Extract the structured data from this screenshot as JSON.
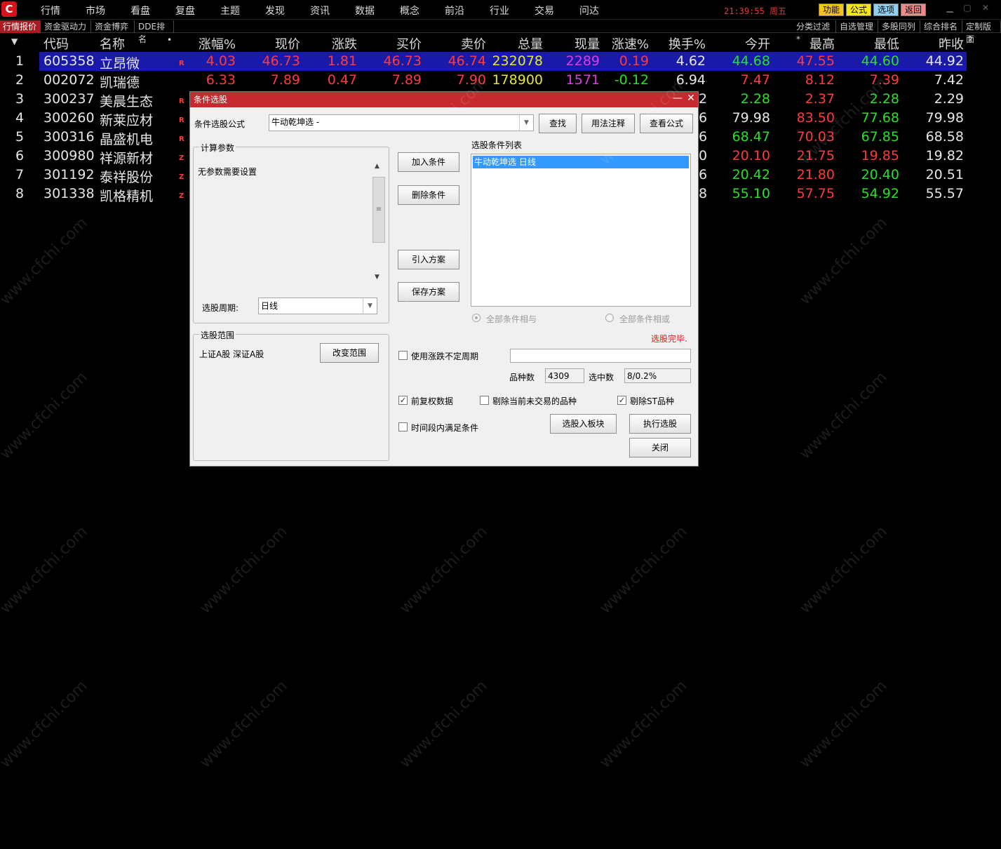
{
  "app": {
    "logo_glyph": "C"
  },
  "menu": [
    "行情",
    "市场",
    "看盘",
    "复盘",
    "主题",
    "发现",
    "资讯",
    "数据",
    "概念",
    "前沿",
    "行业",
    "交易",
    "问达"
  ],
  "clock": "21:39:55 周五",
  "top_buttons": [
    {
      "label": "功能",
      "color": "#f4c514"
    },
    {
      "label": "公式",
      "color": "#f4e321"
    },
    {
      "label": "选项",
      "color": "#8fd0f0"
    },
    {
      "label": "返回",
      "color": "#f08a8a"
    }
  ],
  "tabs_left": [
    "行情报价",
    "资金驱动力",
    "资金博弈",
    "DDE排名"
  ],
  "tabs_right": [
    "分类过滤*",
    "自选管理",
    "多股同列",
    "综合排名",
    "定制版面"
  ],
  "table": {
    "headers": [
      "代码",
      "名称",
      "涨幅%",
      "现价",
      "涨跌",
      "买价",
      "卖价",
      "总量",
      "现量",
      "涨速%",
      "换手%",
      "今开",
      "最高",
      "最低",
      "昨收"
    ],
    "header_extra": {
      "name_dot": "•",
      "help": "?",
      "sort_arrow": "▼"
    },
    "rows": [
      {
        "idx": "1",
        "code": "605358",
        "name": "立昂微",
        "mark": "R",
        "pct": "4.03",
        "price": "46.73",
        "chg": "1.81",
        "bid": "46.73",
        "ask": "46.74",
        "vol": "232078",
        "cur": "2289",
        "speed": "0.19",
        "turn": "4.62",
        "open": "44.68",
        "high": "47.55",
        "low": "44.60",
        "prev": "44.92",
        "speed_c": "red",
        "open_c": "green",
        "high_c": "red",
        "low_c": "green"
      },
      {
        "idx": "2",
        "code": "002072",
        "name": "凯瑞德",
        "mark": "",
        "pct": "6.33",
        "price": "7.89",
        "chg": "0.47",
        "bid": "7.89",
        "ask": "7.90",
        "vol": "178900",
        "cur": "1571",
        "speed": "-0.12",
        "turn": "6.94",
        "open": "7.47",
        "high": "8.12",
        "low": "7.39",
        "prev": "7.42",
        "speed_c": "green",
        "open_c": "red",
        "high_c": "red",
        "low_c": "red"
      },
      {
        "idx": "3",
        "code": "300237",
        "name": "美晨生态",
        "mark": "R",
        "turn_tail": "2",
        "open": "2.28",
        "high": "2.37",
        "low": "2.28",
        "prev": "2.29",
        "open_c": "green",
        "high_c": "red",
        "low_c": "green"
      },
      {
        "idx": "4",
        "code": "300260",
        "name": "新莱应材",
        "mark": "R",
        "turn_tail": "6",
        "open": "79.98",
        "high": "83.50",
        "low": "77.68",
        "prev": "79.98",
        "open_c": "white",
        "high_c": "red",
        "low_c": "green"
      },
      {
        "idx": "5",
        "code": "300316",
        "name": "晶盛机电",
        "mark": "R",
        "turn_tail": "6",
        "open": "68.47",
        "high": "70.03",
        "low": "67.85",
        "prev": "68.58",
        "open_c": "green",
        "high_c": "red",
        "low_c": "green"
      },
      {
        "idx": "6",
        "code": "300980",
        "name": "祥源新材",
        "mark": "Z",
        "turn_tail": "0",
        "open": "20.10",
        "high": "21.75",
        "low": "19.85",
        "prev": "19.82",
        "open_c": "red",
        "high_c": "red",
        "low_c": "red"
      },
      {
        "idx": "7",
        "code": "301192",
        "name": "泰祥股份",
        "mark": "Z",
        "turn_tail": "6",
        "open": "20.42",
        "high": "21.80",
        "low": "20.40",
        "prev": "20.51",
        "open_c": "green",
        "high_c": "red",
        "low_c": "green"
      },
      {
        "idx": "8",
        "code": "301338",
        "name": "凯格精机",
        "mark": "Z",
        "turn_tail": "8",
        "open": "55.10",
        "high": "57.75",
        "low": "54.92",
        "prev": "55.57",
        "open_c": "green",
        "high_c": "red",
        "low_c": "green"
      }
    ]
  },
  "dialog": {
    "title": "条件选股",
    "min_glyph": "—",
    "close_glyph": "✕",
    "formula_label": "条件选股公式",
    "formula_value": "牛动乾坤选   -",
    "find_btn": "查找",
    "usage_btn": "用法注释",
    "view_btn": "查看公式",
    "calc_group": "计算参数",
    "no_params": "无参数需要设置",
    "period_label": "选股周期:",
    "period_value": "日线",
    "add_btn": "加入条件",
    "del_btn": "删除条件",
    "import_btn": "引入方案",
    "save_btn": "保存方案",
    "list_label": "选股条件列表",
    "list_items": [
      "牛动乾坤选  日线"
    ],
    "radio_and": "全部条件相与",
    "radio_or": "全部条件相或",
    "status": "选股完毕.",
    "range_group": "选股范围",
    "range_value": "上证A股 深证A股",
    "change_range_btn": "改变范围",
    "use_period_chk": "使用涨跌不定周期",
    "count_label": "品种数",
    "count_value": "4309",
    "selected_label": "选中数",
    "selected_value": "8/0.2%",
    "fq_chk": "前复权数据",
    "remove_untraded_chk": "剔除当前未交易的品种",
    "remove_st_chk": "剔除ST品种",
    "time_cond_chk": "时间段内满足条件",
    "to_block_btn": "选股入板块",
    "run_btn": "执行选股",
    "close_btn": "关闭",
    "checks": {
      "use_period": false,
      "fq": true,
      "remove_untraded": false,
      "remove_st": true,
      "time_cond": false
    }
  },
  "watermark": "www.cfchi.com"
}
